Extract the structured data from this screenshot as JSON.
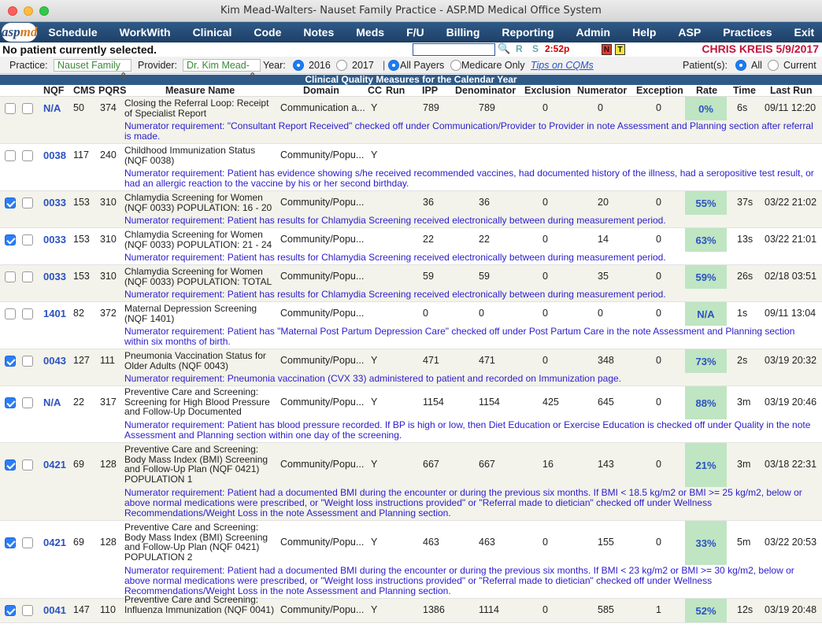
{
  "window": {
    "title": "Kim Mead-Walters- Nauset Family Practice - ASP.MD Medical Office System"
  },
  "logo": {
    "part1": "asp",
    "part2": "md"
  },
  "menu": {
    "left": [
      "Schedule",
      "WorkWith",
      "Clinical",
      "Code",
      "Notes",
      "Meds",
      "F/U",
      "Billing",
      "Reporting",
      "Admin",
      "Help",
      "ASP"
    ],
    "right": [
      "Practices",
      "Exit"
    ]
  },
  "status": {
    "patient": "No patient currently selected.",
    "search_value": "",
    "r_label": "R",
    "s_label": "S",
    "time": "2:52p",
    "badge_n": "N",
    "badge_t": "T",
    "user": "CHRIS KREIS 5/9/2017"
  },
  "filters": {
    "practice_label": "Practice:",
    "practice_value": "Nauset Family",
    "provider_label": "Provider:",
    "provider_value": "Dr. Kim Mead-",
    "year_label": "Year:",
    "year_2016": "2016",
    "year_2017": "2017",
    "all_payers": "All Payers",
    "medicare_only": "Medicare Only",
    "tips_link": "Tips on CQMs",
    "patients_label": "Patient(s):",
    "patients_all": "All",
    "patients_current": "Current"
  },
  "section_title": "Clinical Quality Measures for the Calendar Year",
  "columns": {
    "nqf": "NQF",
    "cms": "CMS",
    "pqrs": "PQRS",
    "measure": "Measure Name",
    "domain": "Domain",
    "cc": "CC",
    "run": "Run",
    "ipp": "IPP",
    "denominator": "Denominator",
    "exclusion": "Exclusion",
    "numerator": "Numerator",
    "exception": "Exception",
    "rate": "Rate",
    "time": "Time",
    "last_run": "Last Run"
  },
  "rows": [
    {
      "checked": false,
      "nqf": "N/A",
      "cms": "50",
      "pqrs": "374",
      "name": "Closing the Referral Loop: Receipt of Specialist Report",
      "domain": "Communication a...",
      "cc": "Y",
      "ipp": "789",
      "den": "789",
      "exc": "0",
      "num": "0",
      "excp": "0",
      "rate": "0%",
      "time": "6s",
      "last": "09/11 12:20",
      "req": "Numerator requirement: \"Consultant Report Received\" checked off under Communication/Provider to Provider in note Assessment and Planning section after referral is made."
    },
    {
      "checked": false,
      "nqf": "0038",
      "cms": "117",
      "pqrs": "240",
      "name": "Childhood Immunization Status (NQF 0038)",
      "domain": "Community/Popu...",
      "cc": "Y",
      "ipp": "",
      "den": "",
      "exc": "",
      "num": "",
      "excp": "",
      "rate": "",
      "time": "",
      "last": "",
      "req": "Numerator requirement: Patient has evidence showing s/he received recommended vaccines, had documented history of the illness, had a seropositive test result, or had an allergic reaction to the vaccine by his or her second birthday."
    },
    {
      "checked": true,
      "nqf": "0033",
      "cms": "153",
      "pqrs": "310",
      "name": "Chlamydia Screening for Women (NQF 0033) POPULATION: 16 - 20",
      "domain": "Community/Popu...",
      "cc": "",
      "ipp": "36",
      "den": "36",
      "exc": "0",
      "num": "20",
      "excp": "0",
      "rate": "55%",
      "time": "37s",
      "last": "03/22 21:02",
      "req": "Numerator requirement: Patient has results for Chlamydia Screening received electronically between during measurement period."
    },
    {
      "checked": true,
      "nqf": "0033",
      "cms": "153",
      "pqrs": "310",
      "name": "Chlamydia Screening for Women (NQF 0033) POPULATION: 21 - 24",
      "domain": "Community/Popu...",
      "cc": "",
      "ipp": "22",
      "den": "22",
      "exc": "0",
      "num": "14",
      "excp": "0",
      "rate": "63%",
      "time": "13s",
      "last": "03/22 21:01",
      "req": "Numerator requirement: Patient has results for Chlamydia Screening received electronically between during measurement period."
    },
    {
      "checked": false,
      "nqf": "0033",
      "cms": "153",
      "pqrs": "310",
      "name": "Chlamydia Screening for Women (NQF 0033) POPULATION: TOTAL",
      "domain": "Community/Popu...",
      "cc": "",
      "ipp": "59",
      "den": "59",
      "exc": "0",
      "num": "35",
      "excp": "0",
      "rate": "59%",
      "time": "26s",
      "last": "02/18 03:51",
      "req": "Numerator requirement: Patient has results for Chlamydia Screening received electronically between during measurement period."
    },
    {
      "checked": false,
      "nqf": "1401",
      "cms": "82",
      "pqrs": "372",
      "name": "Maternal Depression Screening (NQF 1401)",
      "domain": "Community/Popu...",
      "cc": "",
      "ipp": "0",
      "den": "0",
      "exc": "0",
      "num": "0",
      "excp": "0",
      "rate": "N/A",
      "time": "1s",
      "last": "09/11 13:04",
      "req": "Numerator requirement: Patient has \"Maternal Post Partum Depression Care\" checked off under Post Partum Care in the note Assessment and Planning section within six months of birth."
    },
    {
      "checked": true,
      "nqf": "0043",
      "cms": "127",
      "pqrs": "111",
      "name": "Pneumonia Vaccination Status for Older Adults (NQF 0043)",
      "domain": "Community/Popu...",
      "cc": "Y",
      "ipp": "471",
      "den": "471",
      "exc": "0",
      "num": "348",
      "excp": "0",
      "rate": "73%",
      "time": "2s",
      "last": "03/19 20:32",
      "req": "Numerator requirement: Pneumonia vaccination (CVX 33) administered to patient and recorded on Immunization page."
    },
    {
      "checked": true,
      "nqf": "N/A",
      "cms": "22",
      "pqrs": "317",
      "name": "Preventive Care and Screening: Screening for High Blood Pressure and Follow-Up Documented",
      "domain": "Community/Popu...",
      "cc": "Y",
      "ipp": "1154",
      "den": "1154",
      "exc": "425",
      "num": "645",
      "excp": "0",
      "rate": "88%",
      "time": "3m",
      "last": "03/19 20:46",
      "req": "Numerator requirement: Patient has blood pressure recorded. If BP is high or low, then Diet Education or Exercise Education is checked off under Quality in the note Assessment and Planning section within one day of the screening."
    },
    {
      "checked": true,
      "nqf": "0421",
      "cms": "69",
      "pqrs": "128",
      "name": "Preventive Care and Screening: Body Mass Index (BMI) Screening and Follow-Up Plan (NQF 0421) POPULATION 1",
      "domain": "Community/Popu...",
      "cc": "Y",
      "ipp": "667",
      "den": "667",
      "exc": "16",
      "num": "143",
      "excp": "0",
      "rate": "21%",
      "time": "3m",
      "last": "03/18 22:31",
      "req": "Numerator requirement: Patient had a documented BMI during the encounter or during the previous six months. If BMI < 18.5 kg/m2 or BMI >= 25 kg/m2, below or above normal medications were prescribed, or \"Weight loss instructions provided\" or \"Referral made to dietician\" checked off under Wellness Recommendations/Weight Loss in the note Assessment and Planning section."
    },
    {
      "checked": true,
      "nqf": "0421",
      "cms": "69",
      "pqrs": "128",
      "name": "Preventive Care and Screening: Body Mass Index (BMI) Screening and Follow-Up Plan (NQF 0421) POPULATION 2",
      "domain": "Community/Popu...",
      "cc": "Y",
      "ipp": "463",
      "den": "463",
      "exc": "0",
      "num": "155",
      "excp": "0",
      "rate": "33%",
      "time": "5m",
      "last": "03/22 20:53",
      "req": "Numerator requirement: Patient had a documented BMI during the encounter or during the previous six months. If BMI < 23 kg/m2 or BMI >= 30 kg/m2, below or above normal medications were prescribed, or \"Weight loss instructions provided\" or \"Referral made to dietician\" checked off under Wellness Recommendations/Weight Loss in the note Assessment and Planning section."
    },
    {
      "checked": true,
      "nqf": "0041",
      "cms": "147",
      "pqrs": "110",
      "name": "Preventive Care and Screening: Influenza Immunization (NQF 0041)",
      "domain": "Community/Popu...",
      "cc": "Y",
      "ipp": "1386",
      "den": "1114",
      "exc": "0",
      "num": "585",
      "excp": "1",
      "rate": "52%",
      "time": "12s",
      "last": "03/19 20:48",
      "req": ""
    }
  ]
}
